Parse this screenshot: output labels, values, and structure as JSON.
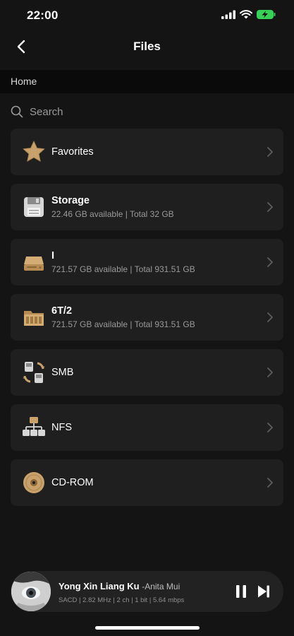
{
  "status": {
    "time": "22:00"
  },
  "nav": {
    "title": "Files"
  },
  "breadcrumb": {
    "label": "Home"
  },
  "search": {
    "placeholder": "Search"
  },
  "items": [
    {
      "title": "Favorites",
      "subtitle": "",
      "icon": "star-icon"
    },
    {
      "title": "Storage",
      "subtitle": "22.46 GB available | Total 32 GB",
      "icon": "storage-icon"
    },
    {
      "title": "I",
      "subtitle": "721.57 GB available | Total 931.51 GB",
      "icon": "drive-icon"
    },
    {
      "title": "6T/2",
      "subtitle": "721.57 GB available | Total 931.51 GB",
      "icon": "drive-icon"
    },
    {
      "title": "SMB",
      "subtitle": "",
      "icon": "smb-icon"
    },
    {
      "title": "NFS",
      "subtitle": "",
      "icon": "nfs-icon"
    },
    {
      "title": "CD-ROM",
      "subtitle": "",
      "icon": "cd-icon"
    }
  ],
  "player": {
    "title": "Yong Xin Liang Ku",
    "artist": "-Anita Mui",
    "meta": "SACD | 2.82 MHz | 2 ch | 1 bit | 5.64 mbps"
  },
  "colors": {
    "background": "#141414",
    "row": "#1f1f1f",
    "accent_gold": "#c9a26b",
    "battery_green": "#37d158"
  }
}
